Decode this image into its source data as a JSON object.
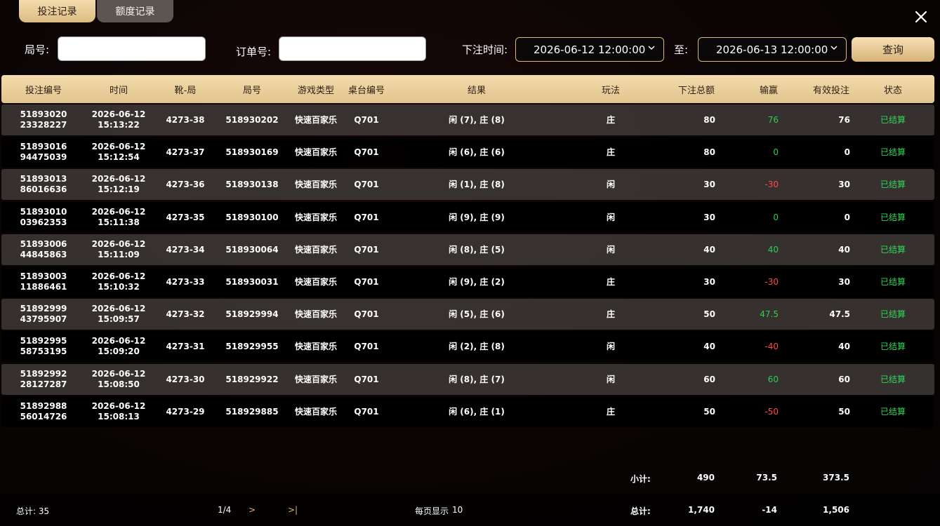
{
  "tabs": [
    {
      "label": "投注记录",
      "active": true
    },
    {
      "label": "额度记录",
      "active": false
    }
  ],
  "filters": {
    "round_label": "局号:",
    "round_value": "",
    "order_label": "订单号:",
    "order_value": "",
    "time_label": "下注时间:",
    "start_time": "2026-06-12 12:00:00",
    "to_label": "至:",
    "end_time": "2026-06-13 12:00:00",
    "query_label": "查询"
  },
  "table": {
    "columns": [
      "投注编号",
      "时间",
      "靴-局",
      "局号",
      "游戏类型",
      "桌台编号",
      "结果",
      "玩法",
      "下注总额",
      "输赢",
      "有效投注",
      "状态"
    ],
    "rows": [
      {
        "id1": "51893020",
        "id2": "23328227",
        "date": "2026-06-12",
        "time": "15:13:22",
        "shoe": "4273-38",
        "round": "518930202",
        "game": "快速百家乐",
        "table": "Q701",
        "result": "闲 (7), 庄 (8)",
        "play": "庄",
        "bet": "80",
        "win": "76",
        "win_sign": "pos",
        "valid": "76",
        "status": "已结算"
      },
      {
        "id1": "51893016",
        "id2": "94475039",
        "date": "2026-06-12",
        "time": "15:12:54",
        "shoe": "4273-37",
        "round": "518930169",
        "game": "快速百家乐",
        "table": "Q701",
        "result": "闲 (6), 庄 (6)",
        "play": "庄",
        "bet": "80",
        "win": "0",
        "win_sign": "pos",
        "valid": "0",
        "status": "已结算"
      },
      {
        "id1": "51893013",
        "id2": "86016636",
        "date": "2026-06-12",
        "time": "15:12:19",
        "shoe": "4273-36",
        "round": "518930138",
        "game": "快速百家乐",
        "table": "Q701",
        "result": "闲 (1), 庄 (8)",
        "play": "闲",
        "bet": "30",
        "win": "-30",
        "win_sign": "neg",
        "valid": "30",
        "status": "已结算"
      },
      {
        "id1": "51893010",
        "id2": "03962353",
        "date": "2026-06-12",
        "time": "15:11:38",
        "shoe": "4273-35",
        "round": "518930100",
        "game": "快速百家乐",
        "table": "Q701",
        "result": "闲 (9), 庄 (9)",
        "play": "闲",
        "bet": "30",
        "win": "0",
        "win_sign": "pos",
        "valid": "0",
        "status": "已结算"
      },
      {
        "id1": "51893006",
        "id2": "44845863",
        "date": "2026-06-12",
        "time": "15:11:09",
        "shoe": "4273-34",
        "round": "518930064",
        "game": "快速百家乐",
        "table": "Q701",
        "result": "闲 (8), 庄 (5)",
        "play": "闲",
        "bet": "40",
        "win": "40",
        "win_sign": "pos",
        "valid": "40",
        "status": "已结算"
      },
      {
        "id1": "51893003",
        "id2": "11886461",
        "date": "2026-06-12",
        "time": "15:10:32",
        "shoe": "4273-33",
        "round": "518930031",
        "game": "快速百家乐",
        "table": "Q701",
        "result": "闲 (9), 庄 (2)",
        "play": "庄",
        "bet": "30",
        "win": "-30",
        "win_sign": "neg",
        "valid": "30",
        "status": "已结算"
      },
      {
        "id1": "51892999",
        "id2": "43795907",
        "date": "2026-06-12",
        "time": "15:09:57",
        "shoe": "4273-32",
        "round": "518929994",
        "game": "快速百家乐",
        "table": "Q701",
        "result": "闲 (5), 庄 (6)",
        "play": "庄",
        "bet": "50",
        "win": "47.5",
        "win_sign": "pos",
        "valid": "47.5",
        "status": "已结算"
      },
      {
        "id1": "51892995",
        "id2": "58753195",
        "date": "2026-06-12",
        "time": "15:09:20",
        "shoe": "4273-31",
        "round": "518929955",
        "game": "快速百家乐",
        "table": "Q701",
        "result": "闲 (2), 庄 (8)",
        "play": "闲",
        "bet": "40",
        "win": "-40",
        "win_sign": "neg",
        "valid": "40",
        "status": "已结算"
      },
      {
        "id1": "51892992",
        "id2": "28127287",
        "date": "2026-06-12",
        "time": "15:08:50",
        "shoe": "4273-30",
        "round": "518929922",
        "game": "快速百家乐",
        "table": "Q701",
        "result": "闲 (8), 庄 (7)",
        "play": "闲",
        "bet": "60",
        "win": "60",
        "win_sign": "pos",
        "valid": "60",
        "status": "已结算"
      },
      {
        "id1": "51892988",
        "id2": "56014726",
        "date": "2026-06-12",
        "time": "15:08:13",
        "shoe": "4273-29",
        "round": "518929885",
        "game": "快速百家乐",
        "table": "Q701",
        "result": "闲 (6), 庄 (1)",
        "play": "庄",
        "bet": "50",
        "win": "-50",
        "win_sign": "neg",
        "valid": "50",
        "status": "已结算"
      }
    ]
  },
  "summary": {
    "subtotal_label": "小计:",
    "subtotal_bet": "490",
    "subtotal_win": "73.5",
    "subtotal_valid": "373.5",
    "total_label": "总计:",
    "total_bet": "1,740",
    "total_win": "-14",
    "total_valid": "1,506"
  },
  "pager": {
    "count_label": "总计: 35",
    "page": "1/4",
    "next": ">",
    "last": ">|",
    "per_page_label": "每页显示",
    "per_page_value": "10"
  },
  "colors": {
    "gold": "#e8cb97",
    "positive": "#2ecc52",
    "negative": "#ff4a4a",
    "status": "#33d25a"
  },
  "icons": {
    "close": "close-icon",
    "dropdown": "chevron-down-icon"
  }
}
